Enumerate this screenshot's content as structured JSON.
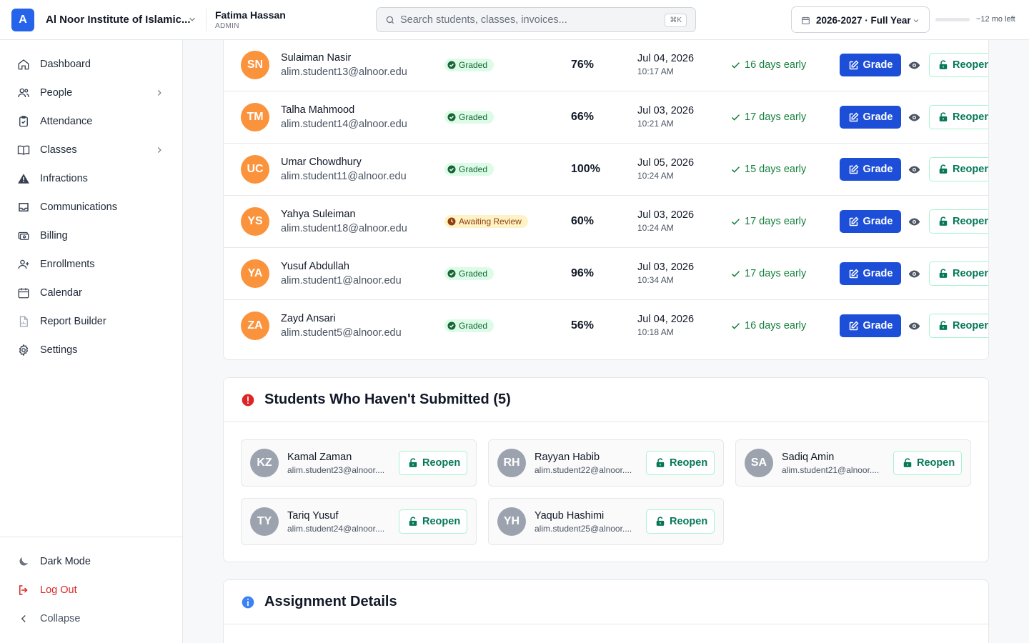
{
  "header": {
    "logo_letter": "A",
    "institution": "Al Noor Institute of Islamic...",
    "user_name": "Fatima Hassan",
    "user_role": "ADMIN",
    "search_placeholder": "Search students, classes, invoices...",
    "search_shortcut": "⌘K",
    "year_label": "2026-2027 · Full Year",
    "time_left": "~12 mo left",
    "progress_fraction": 0
  },
  "sidebar": {
    "items": [
      {
        "label": "Dashboard",
        "icon": "home-icon"
      },
      {
        "label": "People",
        "icon": "users-icon",
        "has_submenu": true
      },
      {
        "label": "Attendance",
        "icon": "clipboard-check-icon"
      },
      {
        "label": "Classes",
        "icon": "book-open-icon",
        "has_submenu": true
      },
      {
        "label": "Infractions",
        "icon": "warning-triangle-icon"
      },
      {
        "label": "Communications",
        "icon": "inbox-icon"
      },
      {
        "label": "Billing",
        "icon": "money-icon"
      },
      {
        "label": "Enrollments",
        "icon": "user-plus-icon"
      },
      {
        "label": "Calendar",
        "icon": "calendar-icon"
      },
      {
        "label": "Report Builder",
        "icon": "report-icon"
      },
      {
        "label": "Settings",
        "icon": "gear-icon"
      }
    ],
    "bottom": [
      {
        "label": "Dark Mode",
        "icon": "moon-icon"
      },
      {
        "label": "Log Out",
        "icon": "logout-icon"
      },
      {
        "label": "Collapse",
        "icon": "chevron-left-icon"
      }
    ]
  },
  "submissions": {
    "grade_label": "Grade",
    "reopen_label": "Reopen",
    "rows": [
      {
        "initials": "SN",
        "name": "Sulaiman Nasir",
        "email": "alim.student13@alnoor.edu",
        "status": "Graded",
        "score": "76%",
        "date": "Jul 04, 2026",
        "time": "10:17 AM",
        "timing": "16 days early"
      },
      {
        "initials": "TM",
        "name": "Talha Mahmood",
        "email": "alim.student14@alnoor.edu",
        "status": "Graded",
        "score": "66%",
        "date": "Jul 03, 2026",
        "time": "10:21 AM",
        "timing": "17 days early"
      },
      {
        "initials": "UC",
        "name": "Umar Chowdhury",
        "email": "alim.student11@alnoor.edu",
        "status": "Graded",
        "score": "100%",
        "date": "Jul 05, 2026",
        "time": "10:24 AM",
        "timing": "15 days early"
      },
      {
        "initials": "YS",
        "name": "Yahya Suleiman",
        "email": "alim.student18@alnoor.edu",
        "status": "Awaiting Review",
        "score": "60%",
        "date": "Jul 03, 2026",
        "time": "10:24 AM",
        "timing": "17 days early"
      },
      {
        "initials": "YA",
        "name": "Yusuf Abdullah",
        "email": "alim.student1@alnoor.edu",
        "status": "Graded",
        "score": "96%",
        "date": "Jul 03, 2026",
        "time": "10:34 AM",
        "timing": "17 days early"
      },
      {
        "initials": "ZA",
        "name": "Zayd Ansari",
        "email": "alim.student5@alnoor.edu",
        "status": "Graded",
        "score": "56%",
        "date": "Jul 04, 2026",
        "time": "10:18 AM",
        "timing": "16 days early"
      }
    ]
  },
  "not_submitted": {
    "title": "Students Who Haven't Submitted (5)",
    "reopen_label": "Reopen",
    "students": [
      {
        "initials": "KZ",
        "name": "Kamal Zaman",
        "email": "alim.student23@alnoor...."
      },
      {
        "initials": "RH",
        "name": "Rayyan Habib",
        "email": "alim.student22@alnoor...."
      },
      {
        "initials": "SA",
        "name": "Sadiq Amin",
        "email": "alim.student21@alnoor...."
      },
      {
        "initials": "TY",
        "name": "Tariq Yusuf",
        "email": "alim.student24@alnoor...."
      },
      {
        "initials": "YH",
        "name": "Yaqub Hashimi",
        "email": "alim.student25@alnoor...."
      }
    ]
  },
  "details": {
    "title": "Assignment Details"
  },
  "colors": {
    "primary": "#1d4ed8",
    "avatar_orange": "#fb923c",
    "avatar_gray": "#9ca3af",
    "success": "#15803d",
    "danger": "#dc2626",
    "info": "#3b82f6"
  }
}
